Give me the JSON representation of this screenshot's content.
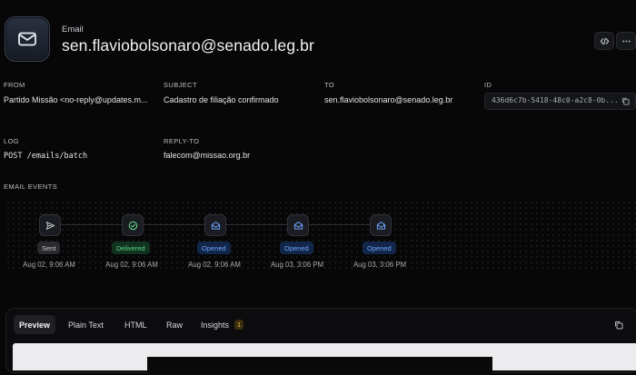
{
  "header": {
    "label": "Email",
    "title": "sen.flaviobolsonaro@senado.leg.br",
    "logo_icon": "mail-icon",
    "actions": [
      {
        "icon": "code-icon"
      },
      {
        "icon": "more-horizontal-icon"
      }
    ]
  },
  "fields": {
    "from": {
      "label": "FROM",
      "value": "Partido Missão <no-reply@updates.m..."
    },
    "subject": {
      "label": "SUBJECT",
      "value": "Cadastro de filiação confirmado"
    },
    "to": {
      "label": "TO",
      "value": "sen.flaviobolsonaro@senado.leg.br"
    },
    "id": {
      "label": "ID",
      "value": "436d6c7b-5418-48c0-a2c8-0b...",
      "copy_icon": "copy-icon"
    },
    "log": {
      "label": "LOG",
      "value": "POST /emails/batch"
    },
    "reply_to": {
      "label": "REPLY-TO",
      "value": "falecom@missao.org.br"
    }
  },
  "events": {
    "title": "EMAIL EVENTS",
    "items": [
      {
        "icon": "send-icon",
        "status": "Sent",
        "time": "Aug 02, 9:06 AM"
      },
      {
        "icon": "check-circle-icon",
        "status": "Delivered",
        "time": "Aug 02, 9:06 AM"
      },
      {
        "icon": "mail-open-icon",
        "status": "Opened",
        "time": "Aug 02, 9:06 AM"
      },
      {
        "icon": "mail-open-icon",
        "status": "Opened",
        "time": "Aug 03, 3:06 PM"
      },
      {
        "icon": "mail-open-icon",
        "status": "Opened",
        "time": "Aug 03, 3:06 PM"
      }
    ]
  },
  "preview": {
    "tabs": [
      "Preview",
      "Plain Text",
      "HTML",
      "Raw",
      "Insights"
    ],
    "active_tab": "Preview",
    "insights_count": "1",
    "copy_icon": "copy-icon"
  },
  "colors": {
    "background": "#070708",
    "delivered": "#5fd58a",
    "opened": "#6fa3ff",
    "insights_badge": "#f2c14e"
  }
}
